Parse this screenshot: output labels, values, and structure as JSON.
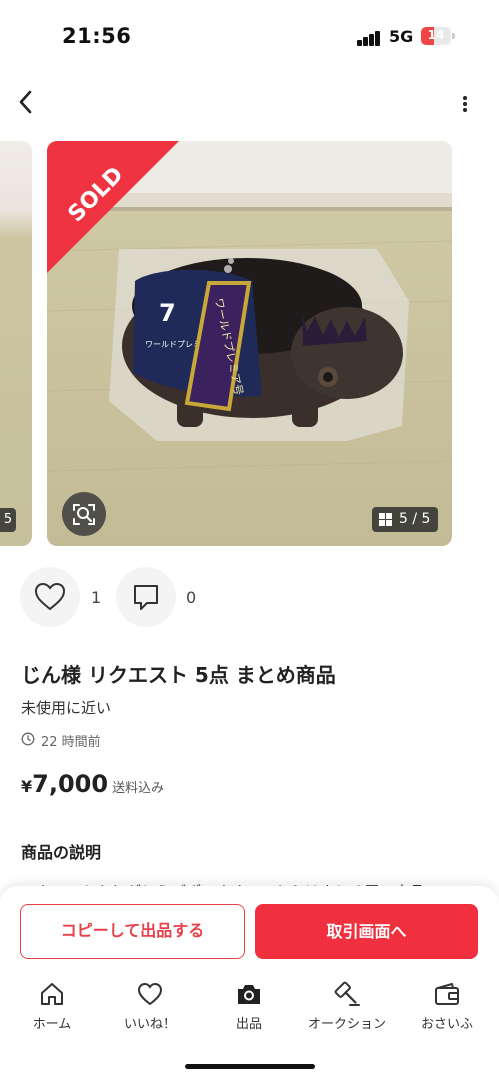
{
  "status_bar": {
    "time": "21:56",
    "network": "5G",
    "battery": "14"
  },
  "header": {
    "back_icon": "chevron-left-icon",
    "menu_icon": "more-vertical-icon"
  },
  "photos": {
    "sold_label": "SOLD",
    "counter": "5 / 5",
    "prev_counter": "5",
    "product_number": "7",
    "product_text": "ワールドプレミア",
    "sash_text": "ワールドプレミア号"
  },
  "actions": {
    "likes": "1",
    "comments": "0"
  },
  "item": {
    "title": "じん様 リクエスト 5点 まとめ商品",
    "condition": "未使用に近い",
    "posted": "22 時間前",
    "price_symbol": "¥",
    "price": "7,000",
    "shipping": "送料込み",
    "description_heading": "商品の説明",
    "description": "リクエストありがとうございます。こちらはまとめ買い商品"
  },
  "buttons": {
    "copy": "コピーして出品する",
    "trade": "取引画面へ"
  },
  "tabs": [
    {
      "label": "ホーム",
      "icon": "home-icon"
    },
    {
      "label": "いいね！",
      "icon": "heart-icon"
    },
    {
      "label": "出品",
      "icon": "camera-icon"
    },
    {
      "label": "オークション",
      "icon": "gavel-icon"
    },
    {
      "label": "おさいふ",
      "icon": "wallet-icon"
    }
  ],
  "colors": {
    "accent": "#f0303f",
    "sold_banner": "#ef3340"
  }
}
